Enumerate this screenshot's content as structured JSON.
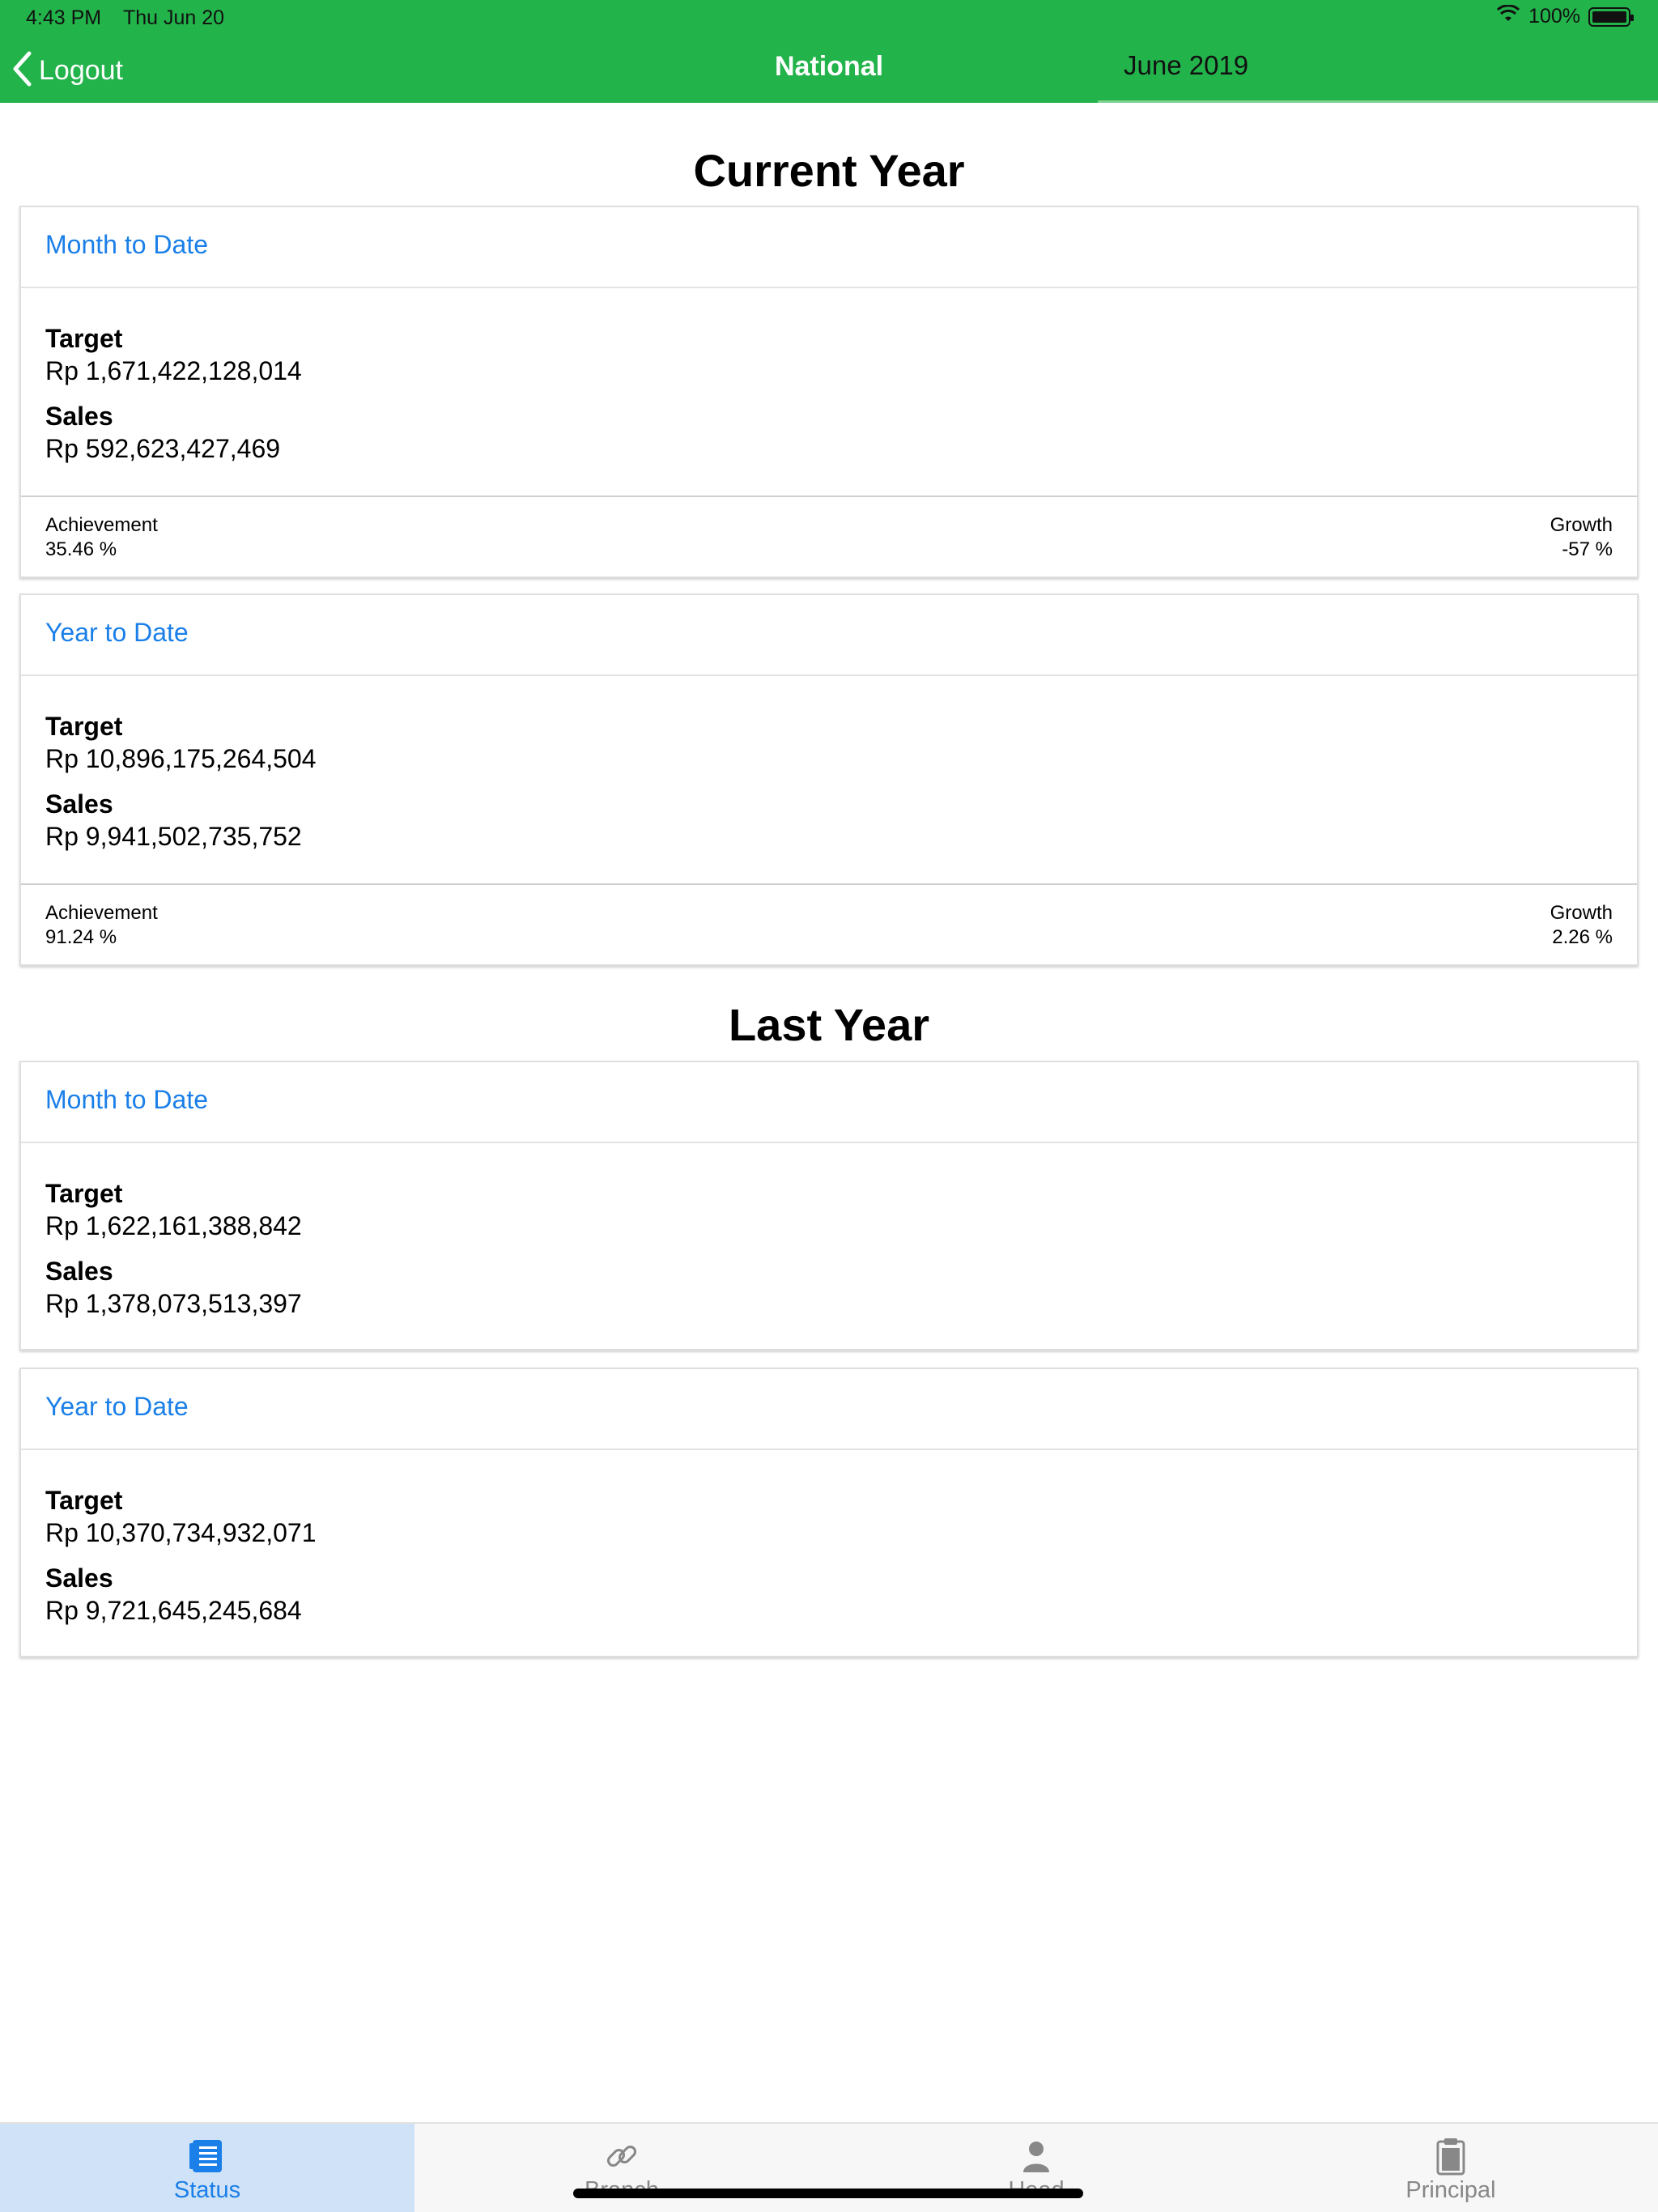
{
  "status_bar": {
    "time": "4:43 PM",
    "date": "Thu Jun 20",
    "battery": "100%"
  },
  "nav": {
    "back_label": "Logout",
    "title": "National",
    "period": "June 2019"
  },
  "current_year": {
    "title": "Current Year",
    "month_to_date": {
      "header": "Month to Date",
      "target_label": "Target",
      "target_value": "Rp 1,671,422,128,014",
      "sales_label": "Sales",
      "sales_value": "Rp 592,623,427,469",
      "achievement_label": "Achievement",
      "achievement_value": "35.46 %",
      "growth_label": "Growth",
      "growth_value": "-57 %"
    },
    "year_to_date": {
      "header": "Year to Date",
      "target_label": "Target",
      "target_value": "Rp 10,896,175,264,504",
      "sales_label": "Sales",
      "sales_value": "Rp 9,941,502,735,752",
      "achievement_label": "Achievement",
      "achievement_value": "91.24 %",
      "growth_label": "Growth",
      "growth_value": "2.26 %"
    }
  },
  "last_year": {
    "title": "Last Year",
    "month_to_date": {
      "header": "Month to Date",
      "target_label": "Target",
      "target_value": "Rp 1,622,161,388,842",
      "sales_label": "Sales",
      "sales_value": "Rp 1,378,073,513,397"
    },
    "year_to_date": {
      "header": "Year to Date",
      "target_label": "Target",
      "target_value": "Rp 10,370,734,932,071",
      "sales_label": "Sales",
      "sales_value": "Rp 9,721,645,245,684"
    }
  },
  "tabs": [
    {
      "label": "Status",
      "icon": "list-icon",
      "active": true
    },
    {
      "label": "Branch",
      "icon": "link-icon",
      "active": false
    },
    {
      "label": "Head",
      "icon": "person-icon",
      "active": false
    },
    {
      "label": "Principal",
      "icon": "clipboard-icon",
      "active": false
    }
  ],
  "colors": {
    "header_green": "#23b34b",
    "accent_blue": "#1a7fe8",
    "active_tab_bg": "#cfe2f7"
  }
}
